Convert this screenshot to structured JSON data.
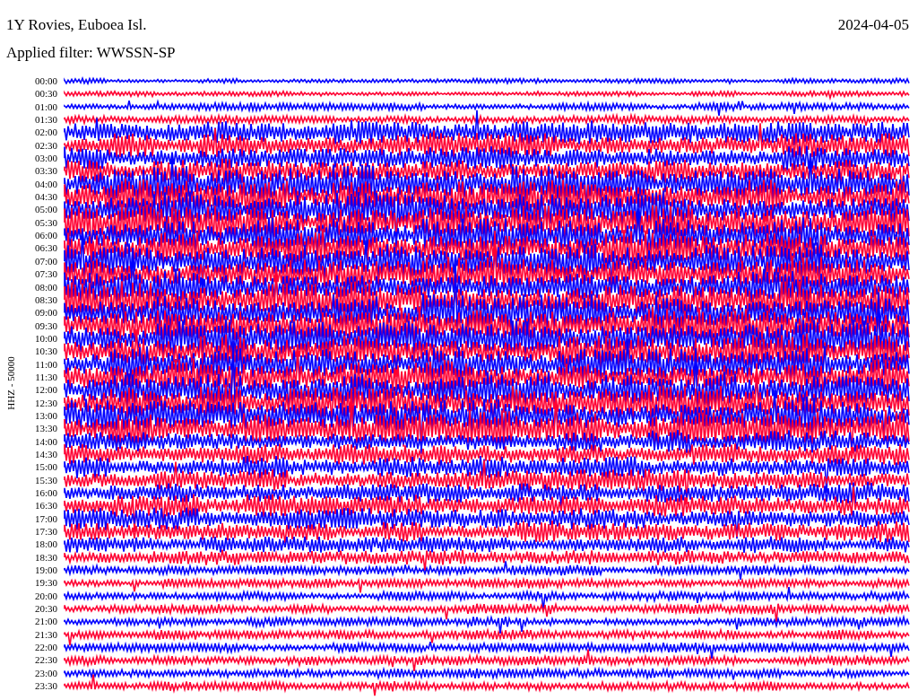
{
  "header": {
    "station": "1Y Rovies, Euboea Isl.",
    "date": "2024-04-05",
    "filter": "Applied filter: WWSSN-SP"
  },
  "channel_label": "HHZ - 50000",
  "rows": [
    {
      "time": "00:00"
    },
    {
      "time": "00:30"
    },
    {
      "time": "01:00"
    },
    {
      "time": "01:30"
    },
    {
      "time": "02:00"
    },
    {
      "time": "02:30"
    },
    {
      "time": "03:00"
    },
    {
      "time": "03:30"
    },
    {
      "time": "04:00"
    },
    {
      "time": "04:30"
    },
    {
      "time": "05:00"
    },
    {
      "time": "05:30"
    },
    {
      "time": "06:00"
    },
    {
      "time": "06:30"
    },
    {
      "time": "07:00"
    },
    {
      "time": "07:30"
    },
    {
      "time": "08:00"
    },
    {
      "time": "08:30"
    },
    {
      "time": "09:00"
    },
    {
      "time": "09:30"
    },
    {
      "time": "10:00"
    },
    {
      "time": "10:30"
    },
    {
      "time": "11:00"
    },
    {
      "time": "11:30"
    },
    {
      "time": "12:00"
    },
    {
      "time": "12:30"
    },
    {
      "time": "13:00"
    },
    {
      "time": "13:30"
    },
    {
      "time": "14:00"
    },
    {
      "time": "14:30"
    },
    {
      "time": "15:00"
    },
    {
      "time": "15:30"
    },
    {
      "time": "16:00"
    },
    {
      "time": "16:30"
    },
    {
      "time": "17:00"
    },
    {
      "time": "17:30"
    },
    {
      "time": "18:00"
    },
    {
      "time": "18:30"
    },
    {
      "time": "19:00"
    },
    {
      "time": "19:30"
    },
    {
      "time": "20:00"
    },
    {
      "time": "20:30"
    },
    {
      "time": "21:00"
    },
    {
      "time": "21:30"
    },
    {
      "time": "22:00"
    },
    {
      "time": "22:30"
    },
    {
      "time": "23:00"
    },
    {
      "time": "23:30"
    }
  ]
}
